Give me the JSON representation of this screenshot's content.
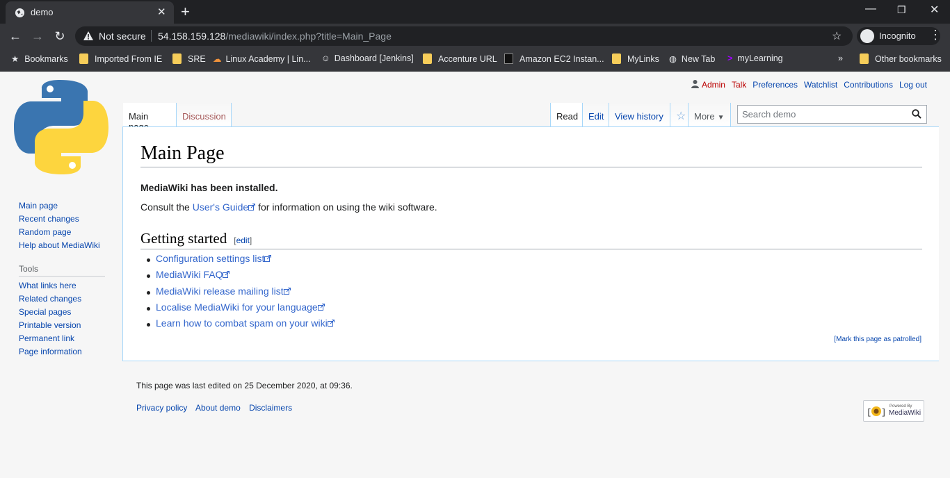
{
  "browser": {
    "tab_title": "demo",
    "not_secure": "Not secure",
    "url_host": "54.158.159.128",
    "url_path": "/mediawiki/index.php?title=Main_Page",
    "incognito": "Incognito",
    "bookmarks": [
      "Bookmarks",
      "Imported From IE",
      "SRE",
      "Linux Academy | Lin...",
      "Dashboard [Jenkins]",
      "Accenture URL",
      "Amazon EC2 Instan...",
      "MyLinks",
      "New Tab",
      "myLearning"
    ],
    "more_bookmarks": "»",
    "other_bookmarks": "Other bookmarks"
  },
  "personal": {
    "user": "Admin",
    "talk": "Talk",
    "preferences": "Preferences",
    "watchlist": "Watchlist",
    "contributions": "Contributions",
    "logout": "Log out"
  },
  "tabs": {
    "main_page": "Main page",
    "discussion": "Discussion",
    "read": "Read",
    "edit": "Edit",
    "history": "View history",
    "more": "More"
  },
  "search": {
    "placeholder": "Search demo"
  },
  "article": {
    "title": "Main Page",
    "installed": "MediaWiki has been installed.",
    "consult_pre": "Consult the ",
    "consult_link": "User's Guide",
    "consult_post": " for information on using the wiki software.",
    "section": "Getting started",
    "edit_open": "[",
    "edit_label": "edit",
    "edit_close": "]",
    "links": [
      "Configuration settings list",
      "MediaWiki FAQ",
      "MediaWiki release mailing list",
      "Localise MediaWiki for your language",
      "Learn how to combat spam on your wiki"
    ],
    "patrol": "[Mark this page as patrolled]"
  },
  "sidebar": {
    "nav": [
      "Main page",
      "Recent changes",
      "Random page",
      "Help about MediaWiki"
    ],
    "tools_heading": "Tools",
    "tools": [
      "What links here",
      "Related changes",
      "Special pages",
      "Printable version",
      "Permanent link",
      "Page information"
    ]
  },
  "footer": {
    "last_edited": "This page was last edited on 25 December 2020, at 09:36.",
    "privacy": "Privacy policy",
    "about": "About demo",
    "disclaimers": "Disclaimers",
    "powered_by": "Powered By",
    "mediawiki": "MediaWiki"
  },
  "colors": {
    "link": "#0645ad",
    "new_link": "#ba0000",
    "border": "#a7d7f9",
    "chrome": "#35363a"
  }
}
